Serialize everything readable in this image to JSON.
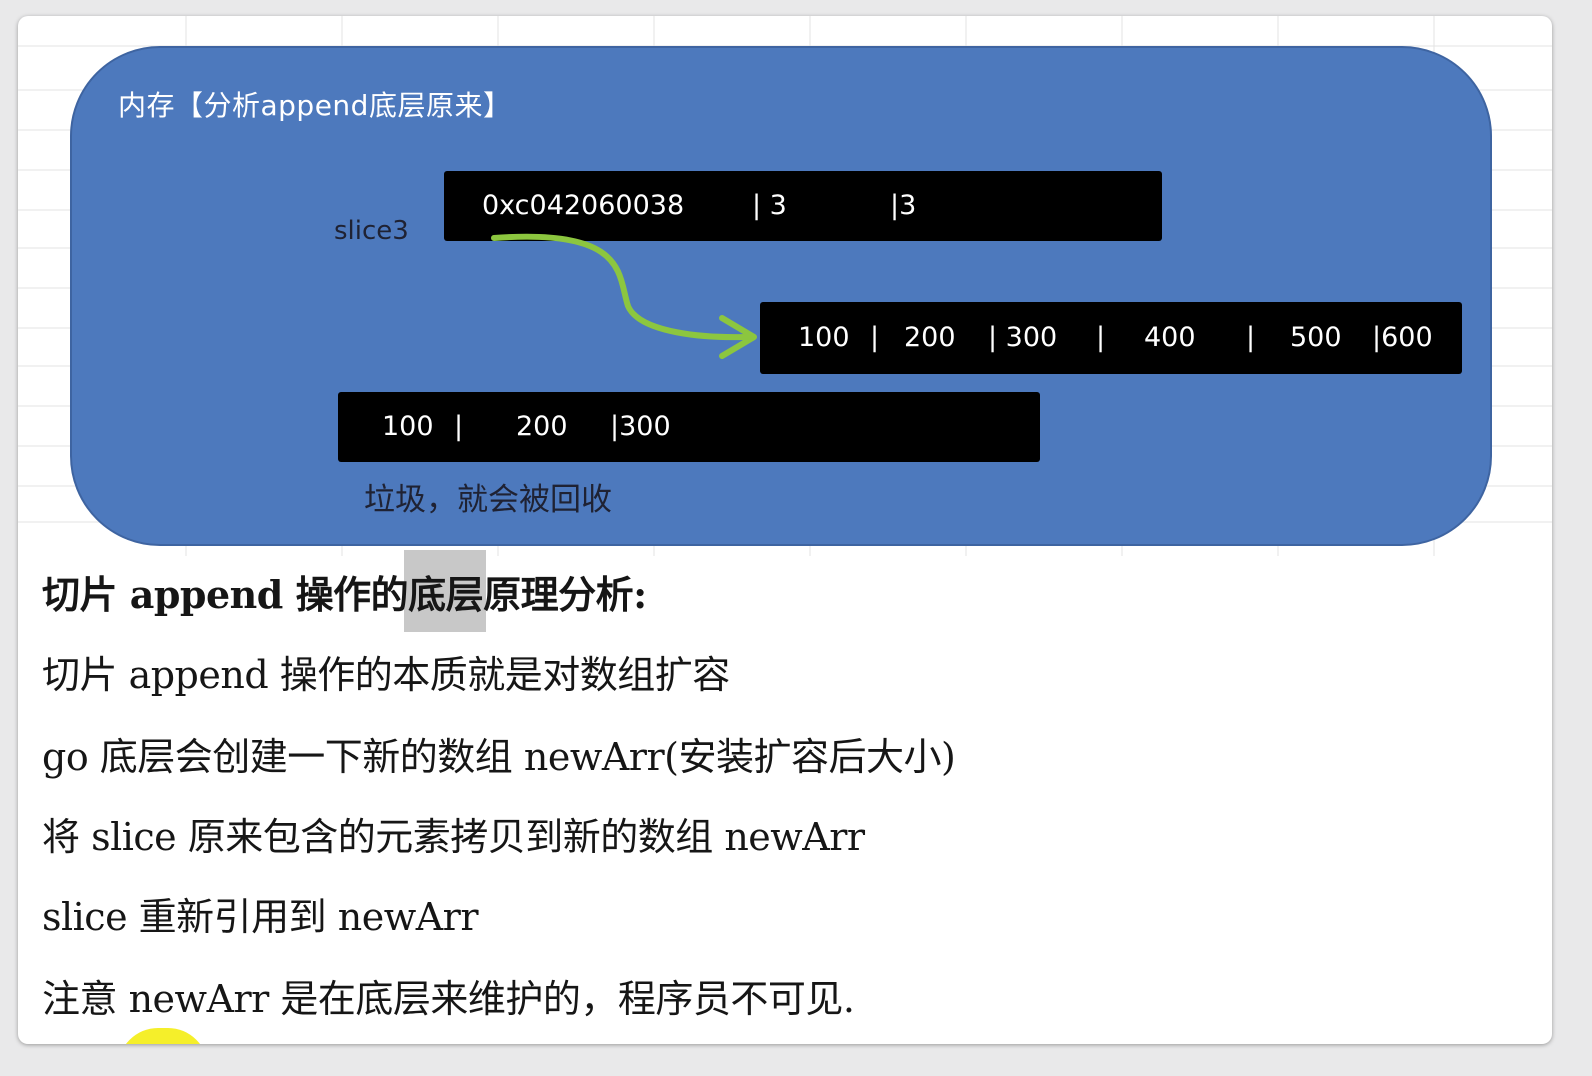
{
  "diagram": {
    "title": "内存【分析append底层原来】",
    "slice_name": "slice3",
    "slice_header": {
      "pointer": "0xc042060038",
      "fields": [
        "| 3",
        "|3"
      ]
    },
    "new_array": {
      "cells": [
        "100",
        "|",
        "200",
        "| 300",
        "|",
        "400",
        "|",
        "500",
        "|600"
      ]
    },
    "old_array": {
      "cells": [
        "100",
        "|",
        "200",
        "|300"
      ]
    },
    "garbage_note": "垃圾，就会被回收",
    "colors": {
      "memory_box": "#4d79bd",
      "bar": "#000000",
      "arrow": "#8cc63f"
    }
  },
  "notes": {
    "heading": "切片 append 操作的底层原理分析:",
    "lines": [
      "切片 append 操作的本质就是对数组扩容",
      "go 底层会创建一下新的数组 newArr(安装扩容后大小)",
      "将 slice 原来包含的元素拷贝到新的数组 newArr",
      "slice  重新引用到 newArr",
      "注意 newArr 是在底层来维护的，程序员不可见."
    ]
  }
}
